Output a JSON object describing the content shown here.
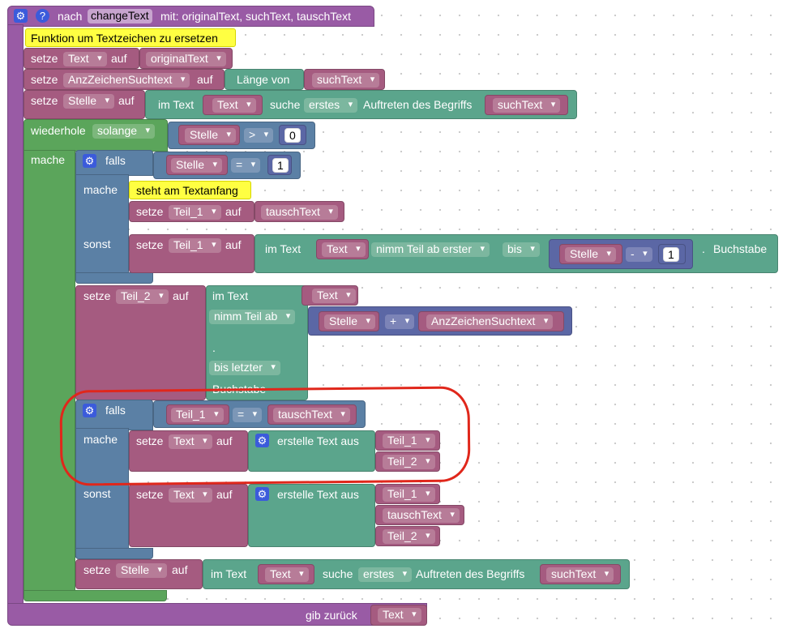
{
  "procedure": {
    "prefix": "nach",
    "name": "changeText",
    "params_label": "mit: originalText, suchText, tauschText",
    "comment": "Funktion um Textzeichen zu ersetzen",
    "return_label": "gib zurück",
    "return_var": "Text"
  },
  "statements": {
    "set_label": "setze",
    "to_label": "auf",
    "set_text": {
      "var": "Text",
      "value": "originalText"
    },
    "set_anz": {
      "var": "AnzZeichenSuchtext",
      "length_label": "Länge von",
      "value": "suchText"
    },
    "set_stelle": {
      "var": "Stelle",
      "in_text": "im Text",
      "text_var": "Text",
      "search_label": "suche",
      "mode": "erstes",
      "occ_label": "Auftreten des Begriffs",
      "term": "suchText"
    }
  },
  "loop": {
    "label": "wiederhole",
    "mode": "solange",
    "do_label": "mache",
    "cond": {
      "var": "Stelle",
      "op": ">",
      "num": "0"
    }
  },
  "if1": {
    "if_label": "falls",
    "do_label": "mache",
    "else_label": "sonst",
    "cond": {
      "var": "Stelle",
      "op": "=",
      "num": "1"
    },
    "comment": "steht am Textanfang",
    "then_set": {
      "var": "Teil_1",
      "value": "tauschText"
    },
    "else_set": {
      "var": "Teil_1",
      "in_text": "im Text",
      "text_var": "Text",
      "substr_mode": "nimm Teil ab erster",
      "to_label": "bis",
      "pos_var": "Stelle",
      "op": "-",
      "num": "1",
      "suffix": ".",
      "unit": "Buchstabe"
    }
  },
  "set_teil2": {
    "var": "Teil_2",
    "in_text": "im Text",
    "text_var": "Text",
    "substr_mode": "nimm Teil ab",
    "pos_var": "Stelle",
    "op": "+",
    "pos_var2": "AnzZeichenSuchtext",
    "dot": ".",
    "end_mode": "bis letzter",
    "unit": "Buchstabe"
  },
  "if2": {
    "if_label": "falls",
    "do_label": "mache",
    "else_label": "sonst",
    "cond": {
      "var": "Teil_1",
      "op": "=",
      "value": "tauschText"
    },
    "then_set": {
      "var": "Text",
      "join_label": "erstelle Text aus",
      "items": [
        "Teil_1",
        "Teil_2"
      ]
    },
    "else_set": {
      "var": "Text",
      "join_label": "erstelle Text aus",
      "items": [
        "Teil_1",
        "tauschText",
        "Teil_2"
      ]
    }
  },
  "set_stelle2": {
    "var": "Stelle",
    "in_text": "im Text",
    "text_var": "Text",
    "search_label": "suche",
    "mode": "erstes",
    "occ_label": "Auftreten des Begriffs",
    "term": "suchText"
  },
  "icons": [
    "gear-icon",
    "help-icon"
  ],
  "colors": {
    "procedure": "#995ba5",
    "variable": "#a55b80",
    "loop": "#5ba55b",
    "logic": "#5b80a5",
    "text": "#5ba58c",
    "math": "#5b67a5",
    "comment": "#ffff42",
    "highlight": "#e0271b"
  }
}
